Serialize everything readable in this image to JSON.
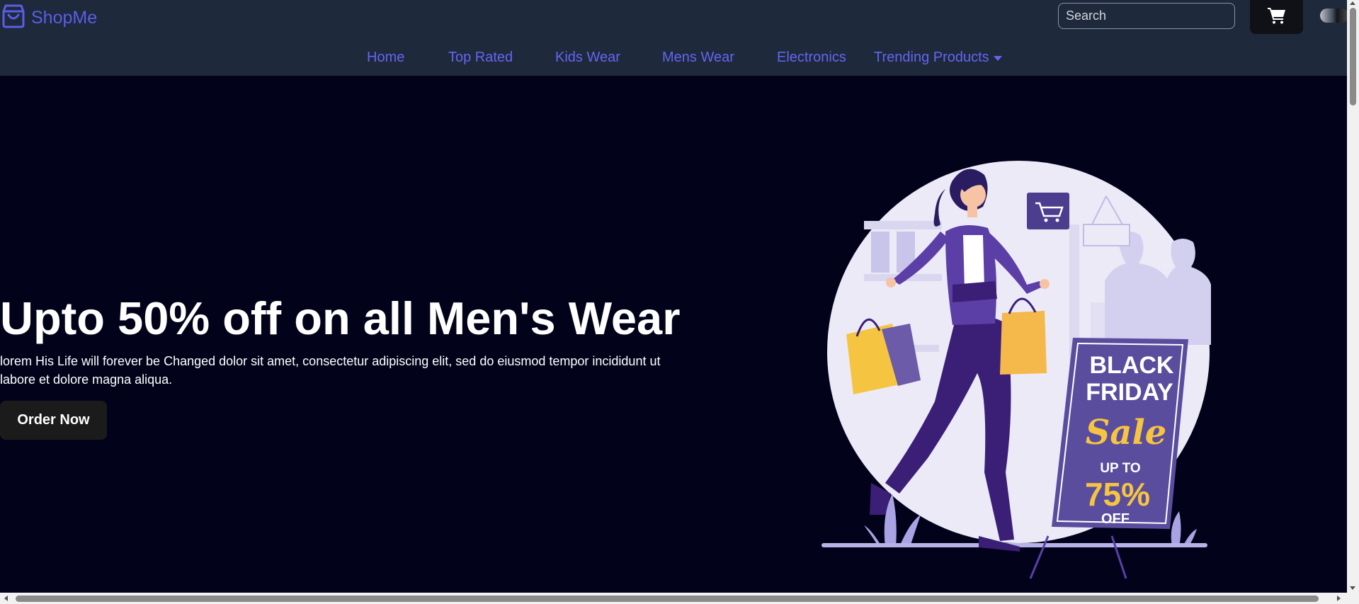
{
  "brand": {
    "name": "ShopMe",
    "icon": "shopping-bag-icon",
    "color": "#5a5ee6"
  },
  "header": {
    "search_placeholder": "Search",
    "cart_icon": "cart-icon",
    "theme_toggle": "dark-mode-toggle"
  },
  "nav": {
    "items": [
      {
        "label": "Home"
      },
      {
        "label": "Top Rated"
      },
      {
        "label": "Kids Wear"
      },
      {
        "label": "Mens Wear"
      },
      {
        "label": "Electronics"
      },
      {
        "label": "Trending Products",
        "dropdown": true
      }
    ]
  },
  "hero": {
    "title": "Upto 50% off on all Men's Wear",
    "description": "lorem His Life will forever be Changed dolor sit amet, consectetur adipiscing elit, sed do eiusmod tempor incididunt ut labore et dolore magna aliqua.",
    "cta_label": "Order Now"
  },
  "illustration": {
    "sign_line1": "BLACK",
    "sign_line2": "FRIDAY",
    "sign_sale": "Sale",
    "sign_upto": "UP TO",
    "sign_percent": "75%",
    "sign_off": "OFF"
  },
  "colors": {
    "header_bg": "#1e293b",
    "hero_bg": "#02031a",
    "accent": "#6366f1",
    "button_bg": "#1c1b1b"
  }
}
